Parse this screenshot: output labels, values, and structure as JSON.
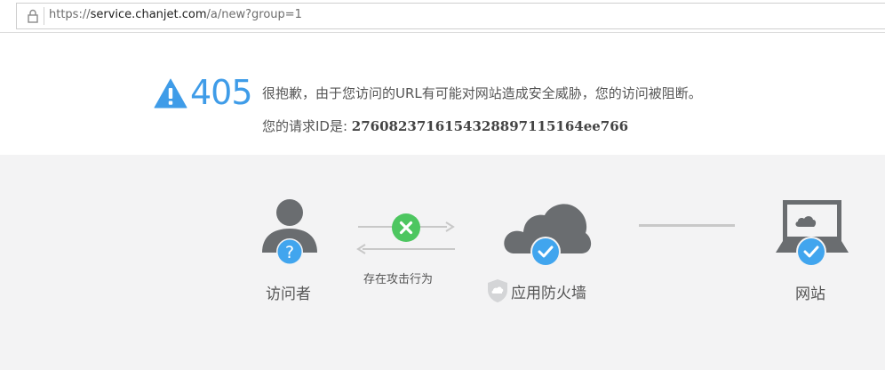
{
  "browser": {
    "url_prefix": "https://",
    "url_host": "service.chanjet.com",
    "url_path": "/a/new?group=1"
  },
  "error": {
    "code": "405",
    "message": "很抱歉，由于您访问的URL有可能对网站造成安全威胁，您的访问被阻断。",
    "request_label": "您的请求ID是: ",
    "request_id": "276082371615432889711​5164ee766"
  },
  "diagram": {
    "visitor_label": "访问者",
    "attack_label": "存在攻击行为",
    "firewall_label": "应用防火墙",
    "website_label": "网站"
  },
  "colors": {
    "accent_blue": "#3f9ce8",
    "icon_gray": "#6a6d70",
    "block_green": "#4dc660",
    "check_blue": "#41a5ee"
  }
}
